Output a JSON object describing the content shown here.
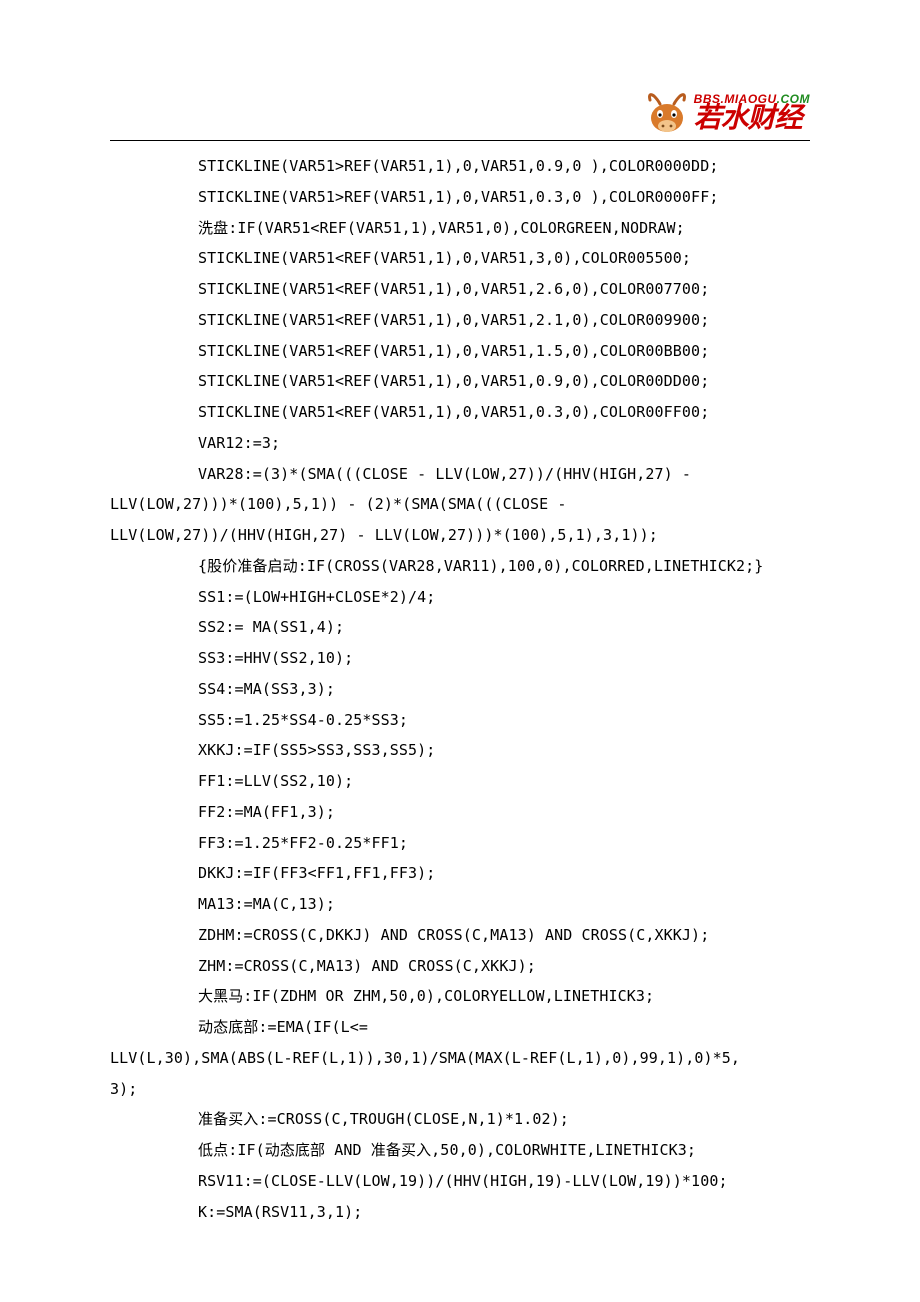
{
  "brand": {
    "url_left": "BBS.MIAOGU",
    "url_right": ".COM",
    "cn": "若水财经"
  },
  "lines": [
    {
      "cls": "indent",
      "text": "STICKLINE(VAR51>REF(VAR51,1),0,VAR51,0.9,0 ),COLOR0000DD;"
    },
    {
      "cls": "indent",
      "text": "STICKLINE(VAR51>REF(VAR51,1),0,VAR51,0.3,0 ),COLOR0000FF;"
    },
    {
      "cls": "indent",
      "text": "洗盘:IF(VAR51<REF(VAR51,1),VAR51,0),COLORGREEN,NODRAW;"
    },
    {
      "cls": "indent",
      "text": "STICKLINE(VAR51<REF(VAR51,1),0,VAR51,3,0),COLOR005500;"
    },
    {
      "cls": "indent",
      "text": "STICKLINE(VAR51<REF(VAR51,1),0,VAR51,2.6,0),COLOR007700;"
    },
    {
      "cls": "indent",
      "text": "STICKLINE(VAR51<REF(VAR51,1),0,VAR51,2.1,0),COLOR009900;"
    },
    {
      "cls": "indent",
      "text": "STICKLINE(VAR51<REF(VAR51,1),0,VAR51,1.5,0),COLOR00BB00;"
    },
    {
      "cls": "indent",
      "text": "STICKLINE(VAR51<REF(VAR51,1),0,VAR51,0.9,0),COLOR00DD00;"
    },
    {
      "cls": "indent",
      "text": "STICKLINE(VAR51<REF(VAR51,1),0,VAR51,0.3,0),COLOR00FF00;"
    },
    {
      "cls": "indent",
      "text": "VAR12:=3;"
    },
    {
      "cls": "indent",
      "text": "VAR28:=(3)*(SMA(((CLOSE - LLV(LOW,27))/(HHV(HIGH,27) -"
    },
    {
      "cls": "noindent",
      "text": "LLV(LOW,27)))*(100),5,1)) - (2)*(SMA(SMA(((CLOSE -"
    },
    {
      "cls": "noindent",
      "text": "LLV(LOW,27))/(HHV(HIGH,27) - LLV(LOW,27)))*(100),5,1),3,1));"
    },
    {
      "cls": "indent",
      "text": "{股价准备启动:IF(CROSS(VAR28,VAR11),100,0),COLORRED,LINETHICK2;}"
    },
    {
      "cls": "indent",
      "text": "SS1:=(LOW+HIGH+CLOSE*2)/4;"
    },
    {
      "cls": "indent",
      "text": "SS2:= MA(SS1,4);"
    },
    {
      "cls": "indent",
      "text": "SS3:=HHV(SS2,10);"
    },
    {
      "cls": "indent",
      "text": "SS4:=MA(SS3,3);"
    },
    {
      "cls": "indent",
      "text": "SS5:=1.25*SS4-0.25*SS3;"
    },
    {
      "cls": "indent",
      "text": "XKKJ:=IF(SS5>SS3,SS3,SS5);"
    },
    {
      "cls": "indent",
      "text": "FF1:=LLV(SS2,10);"
    },
    {
      "cls": "indent",
      "text": "FF2:=MA(FF1,3);"
    },
    {
      "cls": "indent",
      "text": "FF3:=1.25*FF2-0.25*FF1;"
    },
    {
      "cls": "indent",
      "text": "DKKJ:=IF(FF3<FF1,FF1,FF3);"
    },
    {
      "cls": "indent",
      "text": "MA13:=MA(C,13);"
    },
    {
      "cls": "indent",
      "text": "ZDHM:=CROSS(C,DKKJ) AND CROSS(C,MA13) AND CROSS(C,XKKJ);"
    },
    {
      "cls": "indent",
      "text": "ZHM:=CROSS(C,MA13) AND CROSS(C,XKKJ);"
    },
    {
      "cls": "indent",
      "text": "大黑马:IF(ZDHM OR ZHM,50,0),COLORYELLOW,LINETHICK3;"
    },
    {
      "cls": "indent",
      "text": "动态底部:=EMA(IF(L<="
    },
    {
      "cls": "noindent",
      "text": "LLV(L,30),SMA(ABS(L-REF(L,1)),30,1)/SMA(MAX(L-REF(L,1),0),99,1),0)*5,"
    },
    {
      "cls": "noindent",
      "text": "3);"
    },
    {
      "cls": "indent",
      "text": "准备买入:=CROSS(C,TROUGH(CLOSE,N,1)*1.02);"
    },
    {
      "cls": "indent",
      "text": "低点:IF(动态底部 AND 准备买入,50,0),COLORWHITE,LINETHICK3;"
    },
    {
      "cls": "indent",
      "text": "RSV11:=(CLOSE-LLV(LOW,19))/(HHV(HIGH,19)-LLV(LOW,19))*100;"
    },
    {
      "cls": "indent",
      "text": "K:=SMA(RSV11,3,1);"
    }
  ]
}
